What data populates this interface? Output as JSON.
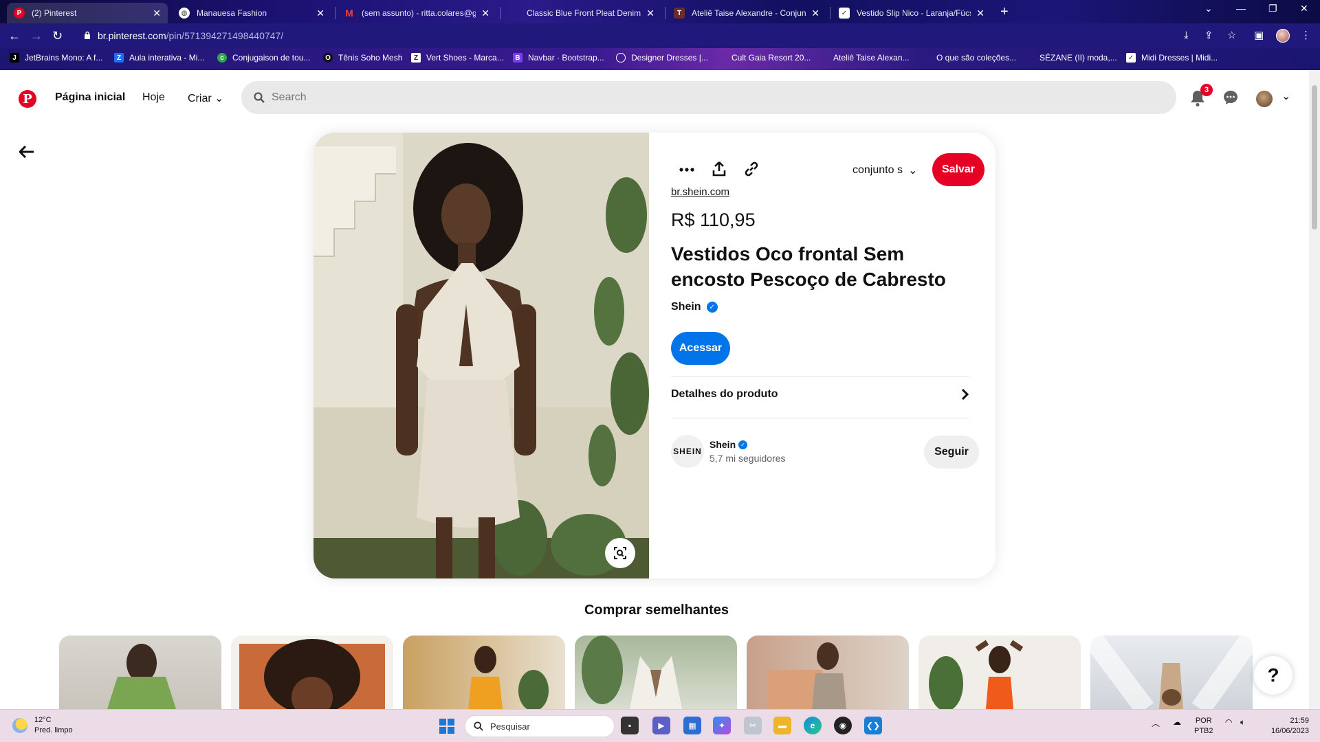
{
  "browser": {
    "tabs": [
      {
        "title": "(2) Pinterest",
        "active": true
      },
      {
        "title": "Manauesa Fashion"
      },
      {
        "title": "(sem assunto) - ritta.colares@gm"
      },
      {
        "title": "Classic Blue Front Pleat Denim -"
      },
      {
        "title": "Ateliê Taise Alexandre - Conjunt"
      },
      {
        "title": "Vestido Slip Nico - Laranja/Fúcsia"
      }
    ],
    "url_host": "br.pinterest.com",
    "url_path": "/pin/571394271498440747/",
    "bookmarks": [
      "JetBrains Mono: A f...",
      "Aula interativa - Mi...",
      "Conjugaison de tou...",
      "Tênis Soho Mesh",
      "Vert Shoes - Marca...",
      "Navbar · Bootstrap...",
      "Designer Dresses |...",
      "Cult Gaia Resort 20...",
      "Ateliê Taise Alexan...",
      "O que são coleções...",
      "SÉZANE (II) moda,...",
      "Midi Dresses | Midi..."
    ]
  },
  "header": {
    "nav_home": "Página inicial",
    "nav_today": "Hoje",
    "nav_create": "Criar",
    "search_placeholder": "Search",
    "notif_count": "3"
  },
  "pin": {
    "board": "conjunto s",
    "save_label": "Salvar",
    "source": "br.shein.com",
    "price": "R$ 110,95",
    "title": "Vestidos Oco frontal Sem encosto Pescoço de Cabresto",
    "brand": "Shein",
    "visit_label": "Acessar",
    "details_label": "Detalhes do produto",
    "creator": {
      "logo_text": "SHEIN",
      "name": "Shein",
      "followers": "5,7 mi seguidores",
      "follow_label": "Seguir"
    }
  },
  "similar": {
    "title": "Comprar semelhantes"
  },
  "taskbar": {
    "temp": "12°C",
    "weather": "Pred. limpo",
    "search_placeholder": "Pesquisar",
    "lang1": "POR",
    "lang2": "PTB2",
    "time": "21:59",
    "date": "16/06/2023"
  },
  "colors": {
    "pinterest_red": "#e60023",
    "accent_blue": "#0074e8"
  }
}
